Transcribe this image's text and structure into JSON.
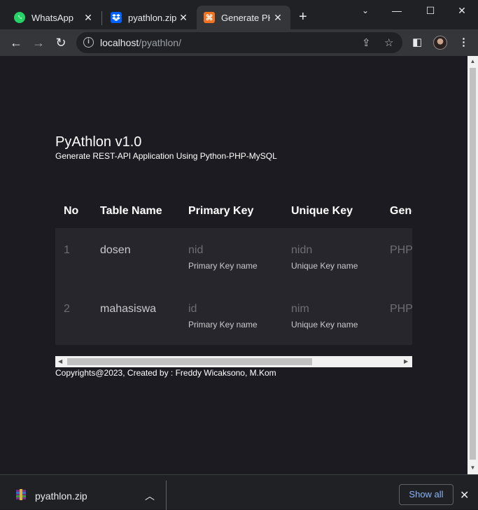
{
  "browser": {
    "tabs": [
      {
        "title": "WhatsApp",
        "icon": "whatsapp-icon",
        "color": "#25d366"
      },
      {
        "title": "pyathlon.zip",
        "icon": "dropbox-icon",
        "color": "#0061fe"
      },
      {
        "title": "Generate PHP",
        "icon": "xampp-icon",
        "color": "#f37321"
      }
    ],
    "url_host": "localhost",
    "url_path": "/pyathlon/"
  },
  "page": {
    "title": "PyAthlon v1.0",
    "subtitle": "Generate REST-API Application Using Python-PHP-MySQL",
    "table": {
      "headers": [
        "No",
        "Table Name",
        "Primary Key",
        "Unique Key",
        "Gene"
      ],
      "rows": [
        {
          "no": "1",
          "table_name": "dosen",
          "primary_key": "nid",
          "primary_hint": "Primary Key name",
          "unique_key": "nidn",
          "unique_hint": "Unique Key name",
          "generate": "PHP"
        },
        {
          "no": "2",
          "table_name": "mahasiswa",
          "primary_key": "id",
          "primary_hint": "Primary Key name",
          "unique_key": "nim",
          "unique_hint": "Unique Key name",
          "generate": "PHP"
        }
      ]
    },
    "footer": "Copyrights@2023, Created by : Freddy Wicaksono, M.Kom"
  },
  "downloads": {
    "file_name": "pyathlon.zip",
    "show_all": "Show all"
  }
}
